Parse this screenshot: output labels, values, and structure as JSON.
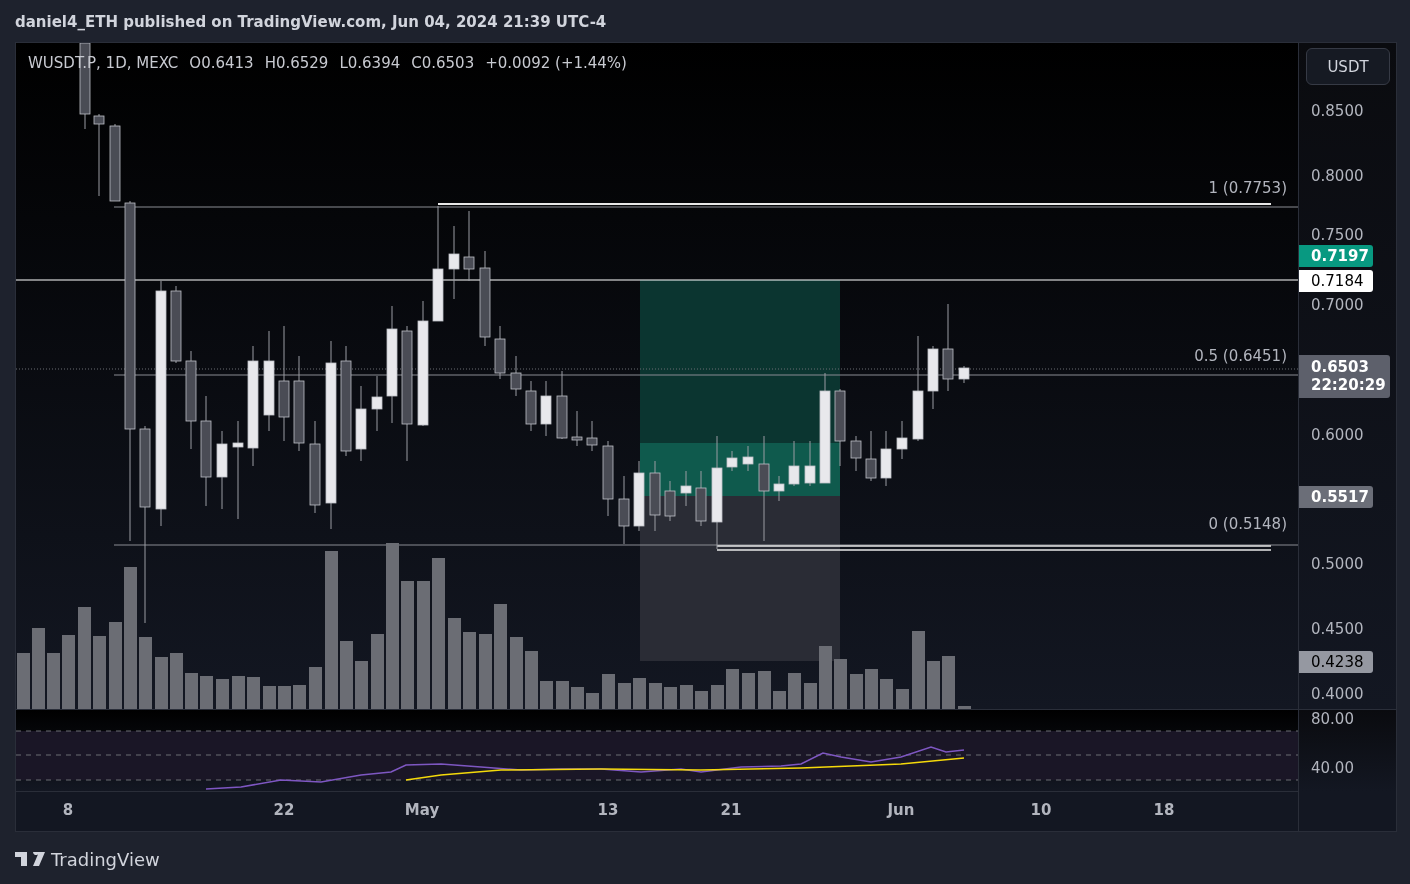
{
  "caption": "daniel4_ETH published on TradingView.com, Jun 04, 2024 21:39 UTC-4",
  "legend": {
    "symbol": "WUSDT.P, 1D, MEXC",
    "values": [
      "O0.6413",
      "H0.6529",
      "L0.6394",
      "C0.6503",
      "+0.0092 (+1.44%)"
    ]
  },
  "fib_labels": [
    "1 (0.7753)",
    "0.5 (0.6451)",
    "0 (0.5148)"
  ],
  "price_scale": {
    "currency_button": "USDT",
    "ticks": [
      "0.8500",
      "0.8000",
      "0.7500",
      "0.7000",
      "0.6000",
      "0.5000",
      "0.4500",
      "0.4000"
    ],
    "badges": [
      {
        "kind": "bid",
        "text": "0.7197"
      },
      {
        "kind": "line",
        "text": "0.7184"
      },
      {
        "kind": "last",
        "text": "0.6503",
        "countdown": "22:20:29"
      },
      {
        "kind": "level",
        "text": "0.5517"
      },
      {
        "kind": "line-grey",
        "text": "0.4238"
      }
    ]
  },
  "rsi_scale": [
    "80.00",
    "40.00"
  ],
  "time_axis": [
    "8",
    "22",
    "May",
    "13",
    "21",
    "Jun",
    "10",
    "18"
  ],
  "footer": {
    "brand": "TradingView"
  }
}
